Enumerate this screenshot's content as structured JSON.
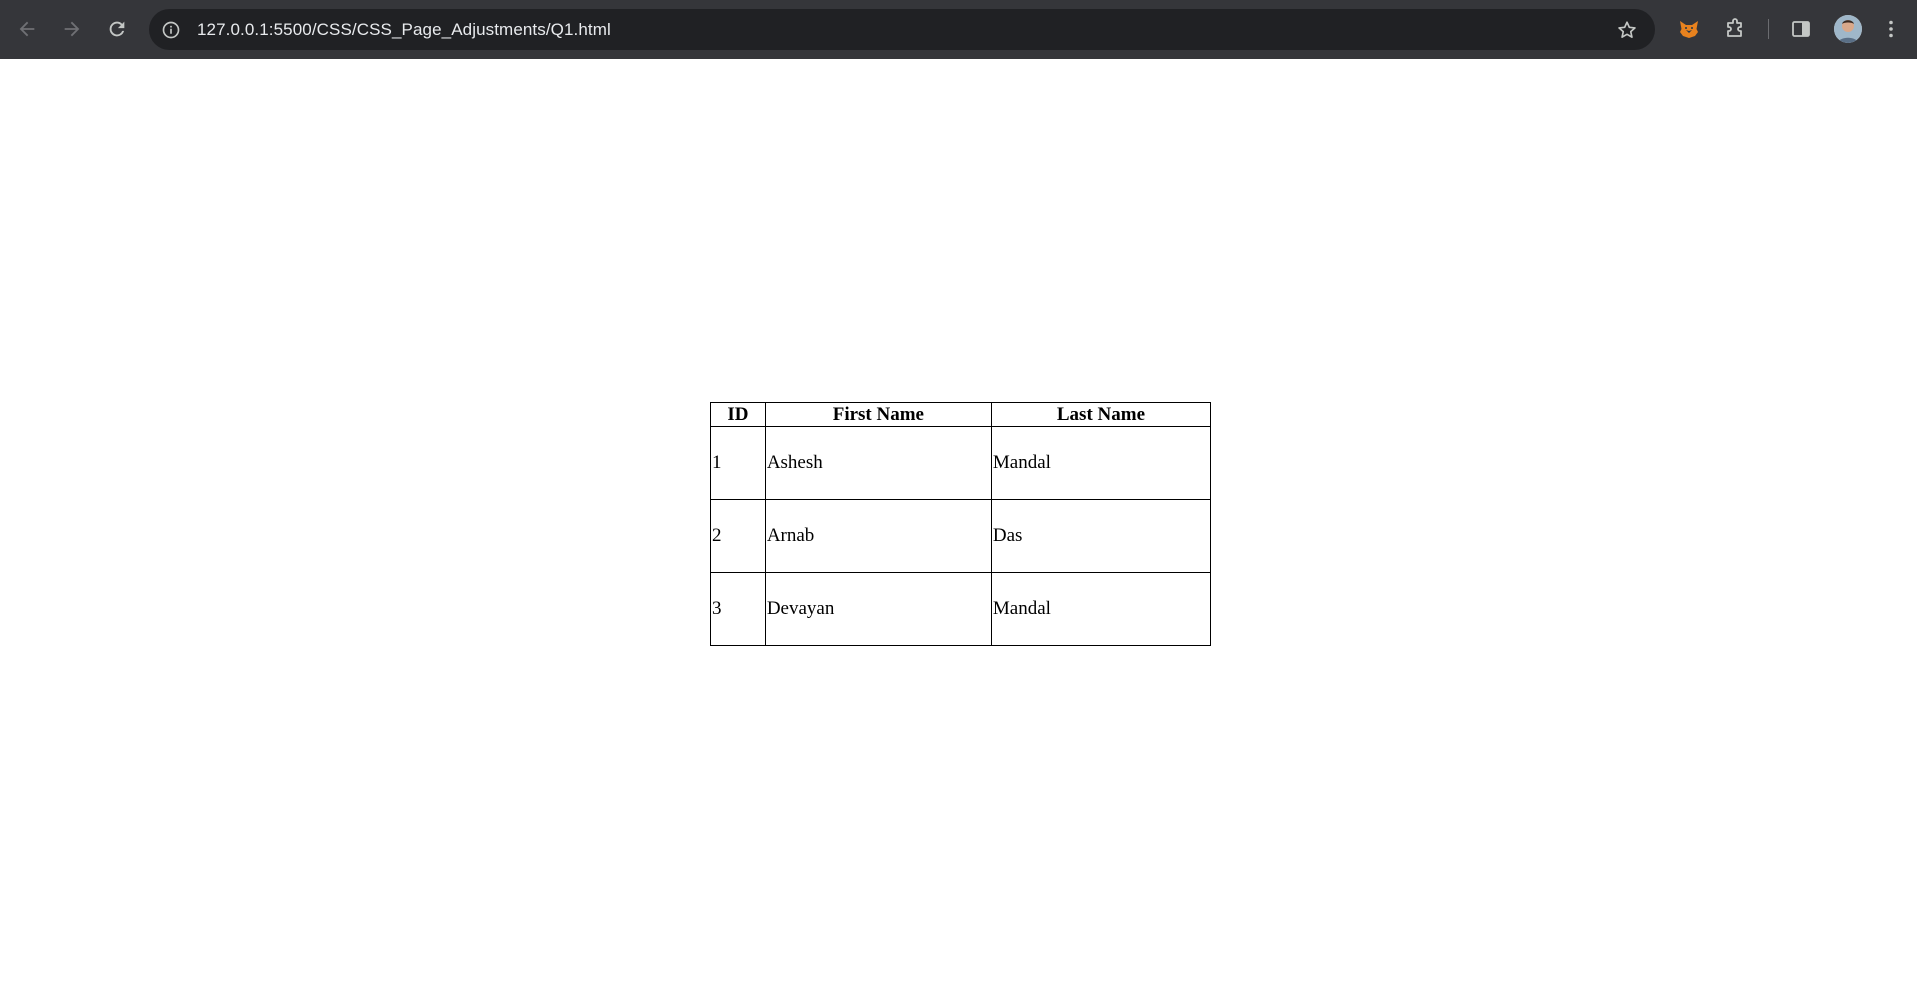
{
  "browser": {
    "url": "127.0.0.1:5500/CSS/CSS_Page_Adjustments/Q1.html",
    "icons": {
      "back": "arrow-left-icon",
      "forward": "arrow-right-icon",
      "reload": "reload-icon",
      "site_info": "info-icon",
      "bookmark": "star-icon",
      "extension_1": "fox-icon",
      "extensions": "puzzle-icon",
      "side_panel": "side-panel-icon",
      "menu": "kebab-icon"
    },
    "colors": {
      "toolbar_bg": "#35363a",
      "omnibox_bg": "#202124",
      "text": "#e8eaed"
    }
  },
  "table": {
    "headers": [
      "ID",
      "First Name",
      "Last Name"
    ],
    "rows": [
      [
        "1",
        "Ashesh",
        "Mandal"
      ],
      [
        "2",
        "Arnab",
        "Das"
      ],
      [
        "3",
        "Devayan",
        "Mandal"
      ]
    ]
  }
}
